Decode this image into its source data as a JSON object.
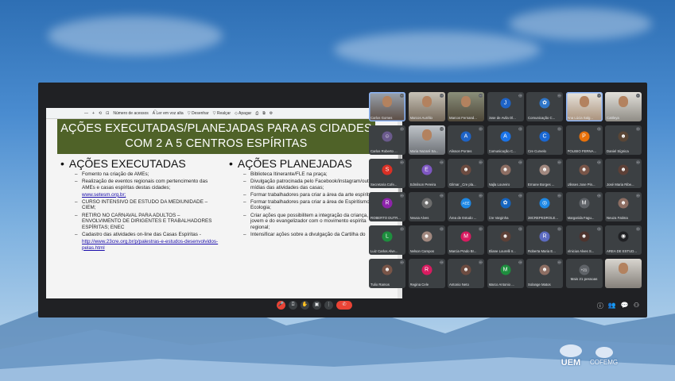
{
  "toolbar": {
    "items": [
      "—",
      "+",
      "⟲",
      "⊡",
      "Número de acessos",
      "A͡ Ler em voz alta",
      "▽ Desenhar",
      "▽ Realçar",
      "◇ Apagar",
      "⎙",
      "⧉",
      "⚙"
    ]
  },
  "slide": {
    "title": "AÇÕES EXECUTADAS/PLANEJADAS PARA AS CIDADES COM 2 A 5 CENTROS ESPÍRITAS",
    "left_heading": "AÇÕES EXECUTADAS",
    "left_items": [
      "Fomento na criação de AMEs;",
      "Realização de eventos regionais com pertencimento das AMEs e casas espíritas destas cidades;",
      "www.setesm.org.br;",
      "CURSO INTENSIVO DE ESTUDO DA MEDIUNIDADE – CIEM;",
      "RETIRO NO CARNAVAL PARA ADULTOS – ENVOLVIMENTO DE DIRIGENTES E TRABALHADORES ESPÍRITAS; ENEC",
      "Cadastro das atividades on-line das Casas Espíritas -",
      "http://www.23cre.org.br/p/palestras-e-estudos-desenvolvidos-pelas.html"
    ],
    "right_heading": "AÇÕES PLANEJADAS",
    "right_items": [
      "Biblioteca Itinerante/FLE na praça;",
      "Divulgação patrocinada pelo Facebook/instagram/outras mídias das atividades das casas;",
      "Formar trabalhadores para criar a área da arte espírita;",
      "Formar trabalhadores para criar a área de Espiritismo e Ecologia;",
      "Criar ações que possibilitem a integração da criança, do jovem e do evangelizador com o movimento espírita regional;",
      "Intensificar ações sobre a divulgação da Cartilha do"
    ]
  },
  "participants": [
    {
      "name": "Carlos Gomes",
      "type": "video",
      "v": "v1",
      "active": true
    },
    {
      "name": "Marcos Aurélio",
      "type": "video",
      "v": "v2"
    },
    {
      "name": "Marcos Fernand...",
      "type": "video",
      "v": "v3"
    },
    {
      "name": "Jose de Avila Ol...",
      "type": "avatar",
      "letter": "J",
      "color": "#1e63c6"
    },
    {
      "name": "Comunicação C...",
      "type": "avatar",
      "letter": "✿",
      "color": "#2f76c9"
    },
    {
      "name": "Ana Lúcia Salg...",
      "type": "video",
      "v": "v4",
      "active": true
    },
    {
      "name": "Cattleya",
      "type": "video",
      "v": "v5"
    },
    {
      "name": "Carlos Roberto ...",
      "type": "avatar",
      "letter": "☺",
      "color": "#6a5a8c"
    },
    {
      "name": "Maria Nazaré Sa...",
      "type": "video",
      "v": "v6"
    },
    {
      "name": "Alisson Pontes",
      "type": "avatar",
      "letter": "A",
      "color": "#1e63c6"
    },
    {
      "name": "Comunicação C...",
      "type": "avatar",
      "letter": "A",
      "color": "#1a73e8"
    },
    {
      "name": "Cre Curvelo",
      "type": "avatar",
      "letter": "C",
      "color": "#1967d2"
    },
    {
      "name": "POLIBIO FERNA...",
      "type": "avatar",
      "letter": "P",
      "color": "#e8710a"
    },
    {
      "name": "Daniel Sígnica",
      "type": "avatar",
      "letter": "☻",
      "color": "#5a4636"
    },
    {
      "name": "Secretaria Cofe...",
      "type": "avatar",
      "letter": "S",
      "color": "#d93025"
    },
    {
      "name": "Edmilson Pereira",
      "type": "avatar",
      "letter": "E",
      "color": "#7e57c2"
    },
    {
      "name": "Gilmar _Cre pla...",
      "type": "avatar",
      "letter": "☻",
      "color": "#6d4c41"
    },
    {
      "name": "Najla Loureiro",
      "type": "avatar",
      "letter": "☻",
      "color": "#8d6e63"
    },
    {
      "name": "Ernane Borges ...",
      "type": "avatar",
      "letter": "☻",
      "color": "#a1887f"
    },
    {
      "name": "Ulisses Jose Pin...",
      "type": "avatar",
      "letter": "☻",
      "color": "#795548"
    },
    {
      "name": "José Maria Ribe...",
      "type": "avatar",
      "letter": "☻",
      "color": "#5d4037"
    },
    {
      "name": "ROBERTO DUTR...",
      "type": "avatar",
      "letter": "R",
      "color": "#8e24aa"
    },
    {
      "name": "Neusa Alves",
      "type": "avatar",
      "letter": "☻",
      "color": "#6d6d6d"
    },
    {
      "name": "Área de Estudo ...",
      "type": "avatar",
      "letter": "AEE",
      "color": "#1e88e5"
    },
    {
      "name": "Cre Varginha",
      "type": "avatar",
      "letter": "✿",
      "color": "#1565c0"
    },
    {
      "name": "28CREPEDROLE...",
      "type": "avatar",
      "letter": "◎",
      "color": "#1e88e5"
    },
    {
      "name": "Margarida Fagu...",
      "type": "avatar",
      "letter": "M",
      "color": "#5f6368"
    },
    {
      "name": "Neuza Fatima",
      "type": "avatar",
      "letter": "☻",
      "color": "#8d6e63"
    },
    {
      "name": "Luiz Carlos Alve...",
      "type": "avatar",
      "letter": "L",
      "color": "#1e8e3e"
    },
    {
      "name": "Nelson Campos",
      "type": "avatar",
      "letter": "☻",
      "color": "#a1887f"
    },
    {
      "name": "Marcia Prado Br...",
      "type": "avatar",
      "letter": "M",
      "color": "#d81b60"
    },
    {
      "name": "Eliane Lourelli Ir...",
      "type": "avatar",
      "letter": "☻",
      "color": "#5d4037"
    },
    {
      "name": "Roberta Maria E...",
      "type": "avatar",
      "letter": "R",
      "color": "#5c6bc0"
    },
    {
      "name": "Vinicius Alves S...",
      "type": "avatar",
      "letter": "☻",
      "color": "#4e342e"
    },
    {
      "name": "AREA DE ESTUD...",
      "type": "avatar",
      "letter": "◉",
      "color": "#202124"
    },
    {
      "name": "Tulio Ramos",
      "type": "avatar",
      "letter": "☻",
      "color": "#795548"
    },
    {
      "name": "Regina Cele",
      "type": "avatar",
      "letter": "R",
      "color": "#d81b60"
    },
    {
      "name": "Antonio Neto",
      "type": "avatar",
      "letter": "☻",
      "color": "#6d4c41"
    },
    {
      "name": "Marco Antonio ...",
      "type": "avatar",
      "letter": "M",
      "color": "#1e8e3e"
    },
    {
      "name": "Solange Matos",
      "type": "avatar",
      "letter": "☻",
      "color": "#8d6e63"
    },
    {
      "name": "Mais 21 pessoas",
      "type": "more",
      "letter": "+21",
      "color": "#5f6368"
    },
    {
      "name": "",
      "type": "video",
      "v": "v7"
    }
  ],
  "controls": {
    "mic_icon": "mic-off-icon",
    "buttons": [
      "🎤",
      "⌼",
      "✋",
      "▣",
      "⋮"
    ],
    "hangup": "✆",
    "right": [
      "ⓘ",
      "👥",
      "💬",
      "⚇"
    ]
  },
  "logos": {
    "uem": "UEM",
    "cofemg": "COFEMG"
  }
}
